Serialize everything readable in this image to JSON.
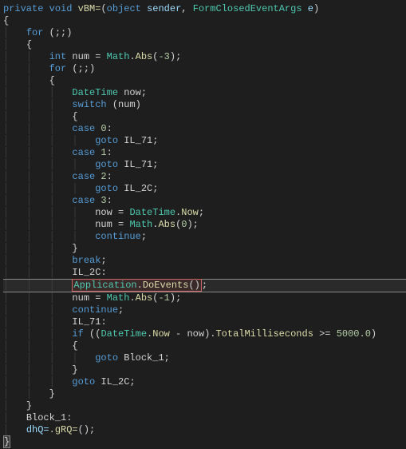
{
  "code": {
    "l1": {
      "kw1": "private",
      "kw2": "void",
      "method": "vBM=",
      "p1": "(",
      "kw3": "object",
      "param1": "sender",
      "c1": ", ",
      "type1": "FormClosedEventArgs",
      "param2": "e",
      "p2": ")"
    },
    "l2": {
      "brace": "{"
    },
    "l3": {
      "kw": "for",
      "rest": " (;;)"
    },
    "l4": {
      "brace": "{"
    },
    "l5": {
      "kw": "int",
      "var": " num = ",
      "type": "Math",
      "dot": ".",
      "method": "Abs",
      "args": "(",
      "num": "-3",
      "end": ");"
    },
    "l6": {
      "kw": "for",
      "rest": " (;;)"
    },
    "l7": {
      "brace": "{"
    },
    "l8": {
      "type": "DateTime",
      "var": " now;"
    },
    "l9": {
      "kw": "switch",
      "rest": " (num)"
    },
    "l10": {
      "brace": "{"
    },
    "l11": {
      "kw": "case",
      "num": " 0",
      "colon": ":"
    },
    "l12": {
      "kw": "goto",
      "label": " IL_71",
      "end": ";"
    },
    "l13": {
      "kw": "case",
      "num": " 1",
      "colon": ":"
    },
    "l14": {
      "kw": "goto",
      "label": " IL_71",
      "end": ";"
    },
    "l15": {
      "kw": "case",
      "num": " 2",
      "colon": ":"
    },
    "l16": {
      "kw": "goto",
      "label": " IL_2C",
      "end": ";"
    },
    "l17": {
      "kw": "case",
      "num": " 3",
      "colon": ":"
    },
    "l18": {
      "var": "now = ",
      "type": "DateTime",
      "dot": ".",
      "prop": "Now",
      "end": ";"
    },
    "l19": {
      "var": "num = ",
      "type": "Math",
      "dot": ".",
      "method": "Abs",
      "args": "(",
      "num": "0",
      "end": ");"
    },
    "l20": {
      "kw": "continue",
      "end": ";"
    },
    "l21": {
      "brace": "}"
    },
    "l22": {
      "kw": "break",
      "end": ";"
    },
    "l23": {
      "label": "IL_2C",
      "colon": ":"
    },
    "l24": {
      "type": "Application",
      "dot": ".",
      "method": "DoEvents",
      "args": "()",
      "end": ";"
    },
    "l25": {
      "var": "num = ",
      "type": "Math",
      "dot": ".",
      "method": "Abs",
      "args": "(",
      "num": "-1",
      "end": ");"
    },
    "l26": {
      "kw": "continue",
      "end": ";"
    },
    "l27": {
      "label": "IL_71",
      "colon": ":"
    },
    "l28": {
      "kw": "if",
      "p1": " ((",
      "type": "DateTime",
      "dot": ".",
      "prop": "Now",
      "op": " - now).",
      "prop2": "TotalMilliseconds",
      "op2": " >= ",
      "num": "5000.0",
      "end": ")"
    },
    "l29": {
      "brace": "{"
    },
    "l30": {
      "kw": "goto",
      "label": " Block_1",
      "end": ";"
    },
    "l31": {
      "brace": "}"
    },
    "l32": {
      "kw": "goto",
      "label": " IL_2C",
      "end": ";"
    },
    "l33": {
      "brace": "}"
    },
    "l34": {
      "brace": "}"
    },
    "l35": {
      "label": "Block_1",
      "colon": ":"
    },
    "l36": {
      "field": "dhQ=",
      "dot": ".",
      "method": "gRQ=",
      "args": "()",
      "end": ";"
    },
    "l37": {
      "brace": "}"
    }
  }
}
